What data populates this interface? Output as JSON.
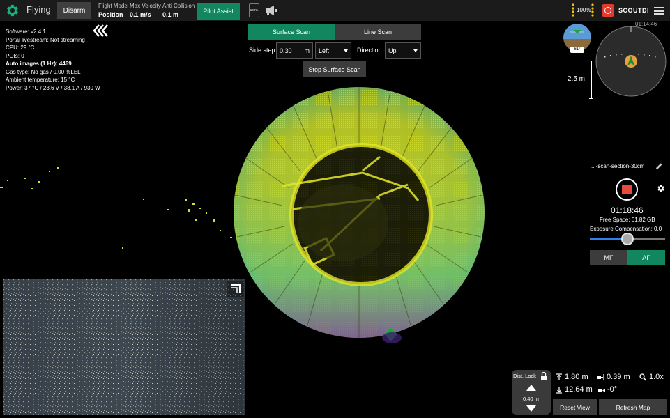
{
  "topbar": {
    "status": "Flying",
    "disarm_label": "Disarm",
    "flight_mode_label": "Flight Mode",
    "flight_mode_value": "Position",
    "max_velocity_label": "Max Velocity",
    "max_velocity_value": "0.1 m/s",
    "anti_collision_label": "Anti Collision",
    "anti_collision_value": "0.1 m",
    "pilot_assist_label": "Pilot Assist",
    "phone_battery": "100%",
    "battery": "100%",
    "brand": "SCOUTDI",
    "accent_color": "#12865f"
  },
  "info": {
    "software": "Software: v2.4.1",
    "livestream": "Portal livestream: Not streaming",
    "cpu": "CPU: 29 °C",
    "pois": "POIs: 0",
    "auto_images": "Auto images (1 Hz): 4469",
    "gas": "Gas type: No gas / 0.00 %LEL",
    "ambient": "Ambient temperature: 15 °C",
    "power": "Power: 37 °C / 23.6 V / 38.1 A / 930 W"
  },
  "scan": {
    "tab_surface": "Surface Scan",
    "tab_line": "Line Scan",
    "side_step_label": "Side step:",
    "side_step_value": "0.30",
    "side_step_unit": "m",
    "side_value": "Left",
    "direction_label": "Direction:",
    "direction_value": "Up",
    "stop_label": "Stop Surface Scan"
  },
  "instruments": {
    "attitude_label": "61°",
    "scale_label": "2.5 m",
    "clock": "01:14:46"
  },
  "recording": {
    "scan_name": "...-scan-section-30cm",
    "time": "01:18:46",
    "free_space": "Free Space: 61.82 GB",
    "exposure": "Exposure Compensation: 0.0",
    "exposure_level": 0.5,
    "mf_label": "MF",
    "af_label": "AF"
  },
  "bottom": {
    "dist_lock_label": "Dist. Lock",
    "dist_lock_value": "0.40 m",
    "height_up": "1.80 m",
    "distance_front": "0.39 m",
    "zoom": "1.0x",
    "height_down": "12.64 m",
    "camera_angle": "-0°",
    "reset_view": "Reset View",
    "refresh_map": "Refresh Map"
  }
}
